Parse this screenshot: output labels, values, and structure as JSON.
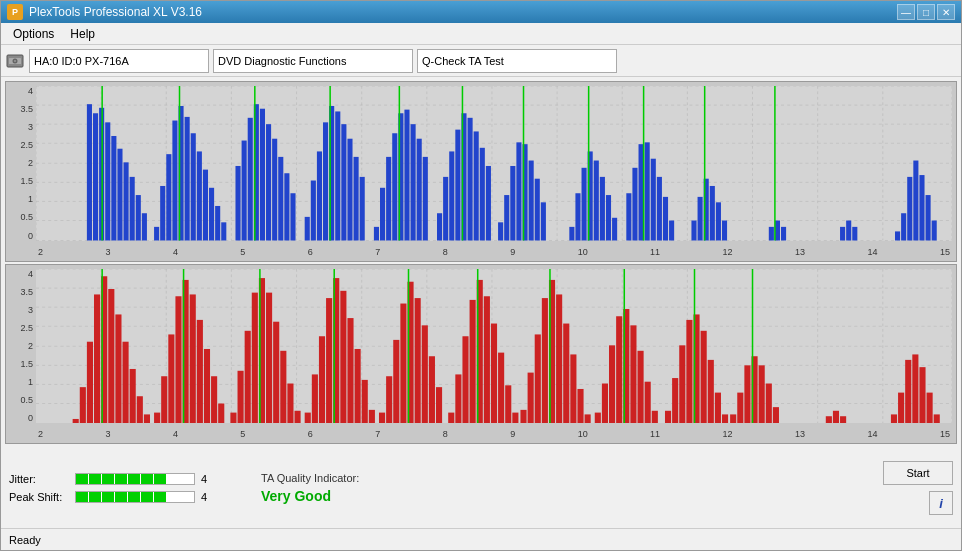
{
  "window": {
    "title": "PlexTools Professional XL V3.16",
    "icon": "P"
  },
  "menu": {
    "items": [
      "Options",
      "Help"
    ]
  },
  "toolbar": {
    "drive": "HA:0 ID:0  PX-716A",
    "function": "DVD Diagnostic Functions",
    "test": "Q-Check TA Test"
  },
  "charts": {
    "top": {
      "y_labels": [
        "4",
        "3.5",
        "3",
        "2.5",
        "2",
        "1.5",
        "1",
        "0.5",
        "0"
      ],
      "x_labels": [
        "2",
        "3",
        "4",
        "5",
        "6",
        "7",
        "8",
        "9",
        "10",
        "11",
        "12",
        "13",
        "14",
        "15"
      ]
    },
    "bottom": {
      "y_labels": [
        "4",
        "3.5",
        "3",
        "2.5",
        "2",
        "1.5",
        "1",
        "0.5",
        "0"
      ],
      "x_labels": [
        "2",
        "3",
        "4",
        "5",
        "6",
        "7",
        "8",
        "9",
        "10",
        "11",
        "12",
        "13",
        "14",
        "15"
      ]
    }
  },
  "metrics": {
    "jitter_label": "Jitter:",
    "jitter_value": "4",
    "jitter_segments": 7,
    "peak_shift_label": "Peak Shift:",
    "peak_shift_value": "4",
    "peak_shift_segments": 7,
    "ta_label": "TA Quality Indicator:",
    "ta_value": "Very Good"
  },
  "buttons": {
    "start": "Start",
    "info": "i"
  },
  "status": {
    "text": "Ready"
  },
  "title_controls": {
    "minimize": "—",
    "maximize": "□",
    "close": "✕"
  }
}
